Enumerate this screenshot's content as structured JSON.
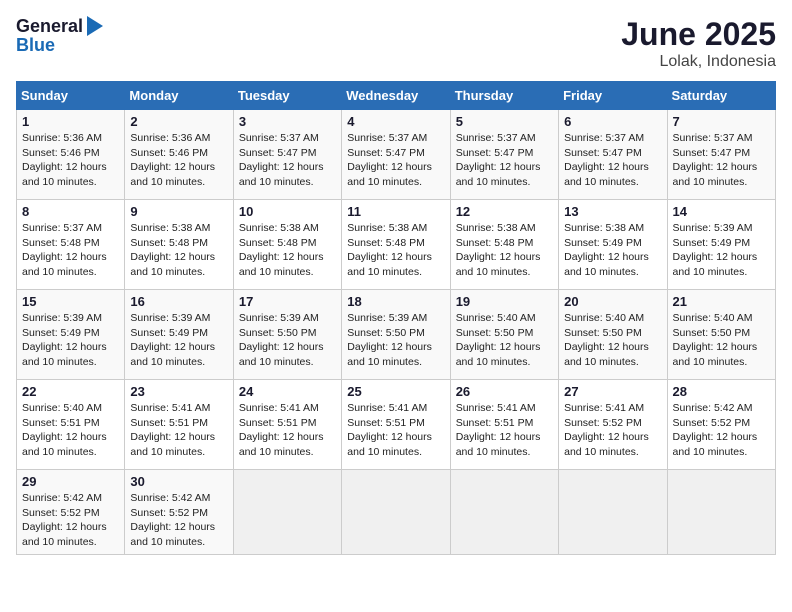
{
  "header": {
    "logo_general": "General",
    "logo_blue": "Blue",
    "title": "June 2025",
    "location": "Lolak, Indonesia"
  },
  "weekdays": [
    "Sunday",
    "Monday",
    "Tuesday",
    "Wednesday",
    "Thursday",
    "Friday",
    "Saturday"
  ],
  "weeks": [
    [
      {
        "day": "1",
        "sunrise": "5:36 AM",
        "sunset": "5:46 PM",
        "daylight": "12 hours and 10 minutes."
      },
      {
        "day": "2",
        "sunrise": "5:36 AM",
        "sunset": "5:46 PM",
        "daylight": "12 hours and 10 minutes."
      },
      {
        "day": "3",
        "sunrise": "5:37 AM",
        "sunset": "5:47 PM",
        "daylight": "12 hours and 10 minutes."
      },
      {
        "day": "4",
        "sunrise": "5:37 AM",
        "sunset": "5:47 PM",
        "daylight": "12 hours and 10 minutes."
      },
      {
        "day": "5",
        "sunrise": "5:37 AM",
        "sunset": "5:47 PM",
        "daylight": "12 hours and 10 minutes."
      },
      {
        "day": "6",
        "sunrise": "5:37 AM",
        "sunset": "5:47 PM",
        "daylight": "12 hours and 10 minutes."
      },
      {
        "day": "7",
        "sunrise": "5:37 AM",
        "sunset": "5:47 PM",
        "daylight": "12 hours and 10 minutes."
      }
    ],
    [
      {
        "day": "8",
        "sunrise": "5:37 AM",
        "sunset": "5:48 PM",
        "daylight": "12 hours and 10 minutes."
      },
      {
        "day": "9",
        "sunrise": "5:38 AM",
        "sunset": "5:48 PM",
        "daylight": "12 hours and 10 minutes."
      },
      {
        "day": "10",
        "sunrise": "5:38 AM",
        "sunset": "5:48 PM",
        "daylight": "12 hours and 10 minutes."
      },
      {
        "day": "11",
        "sunrise": "5:38 AM",
        "sunset": "5:48 PM",
        "daylight": "12 hours and 10 minutes."
      },
      {
        "day": "12",
        "sunrise": "5:38 AM",
        "sunset": "5:48 PM",
        "daylight": "12 hours and 10 minutes."
      },
      {
        "day": "13",
        "sunrise": "5:38 AM",
        "sunset": "5:49 PM",
        "daylight": "12 hours and 10 minutes."
      },
      {
        "day": "14",
        "sunrise": "5:39 AM",
        "sunset": "5:49 PM",
        "daylight": "12 hours and 10 minutes."
      }
    ],
    [
      {
        "day": "15",
        "sunrise": "5:39 AM",
        "sunset": "5:49 PM",
        "daylight": "12 hours and 10 minutes."
      },
      {
        "day": "16",
        "sunrise": "5:39 AM",
        "sunset": "5:49 PM",
        "daylight": "12 hours and 10 minutes."
      },
      {
        "day": "17",
        "sunrise": "5:39 AM",
        "sunset": "5:50 PM",
        "daylight": "12 hours and 10 minutes."
      },
      {
        "day": "18",
        "sunrise": "5:39 AM",
        "sunset": "5:50 PM",
        "daylight": "12 hours and 10 minutes."
      },
      {
        "day": "19",
        "sunrise": "5:40 AM",
        "sunset": "5:50 PM",
        "daylight": "12 hours and 10 minutes."
      },
      {
        "day": "20",
        "sunrise": "5:40 AM",
        "sunset": "5:50 PM",
        "daylight": "12 hours and 10 minutes."
      },
      {
        "day": "21",
        "sunrise": "5:40 AM",
        "sunset": "5:50 PM",
        "daylight": "12 hours and 10 minutes."
      }
    ],
    [
      {
        "day": "22",
        "sunrise": "5:40 AM",
        "sunset": "5:51 PM",
        "daylight": "12 hours and 10 minutes."
      },
      {
        "day": "23",
        "sunrise": "5:41 AM",
        "sunset": "5:51 PM",
        "daylight": "12 hours and 10 minutes."
      },
      {
        "day": "24",
        "sunrise": "5:41 AM",
        "sunset": "5:51 PM",
        "daylight": "12 hours and 10 minutes."
      },
      {
        "day": "25",
        "sunrise": "5:41 AM",
        "sunset": "5:51 PM",
        "daylight": "12 hours and 10 minutes."
      },
      {
        "day": "26",
        "sunrise": "5:41 AM",
        "sunset": "5:51 PM",
        "daylight": "12 hours and 10 minutes."
      },
      {
        "day": "27",
        "sunrise": "5:41 AM",
        "sunset": "5:52 PM",
        "daylight": "12 hours and 10 minutes."
      },
      {
        "day": "28",
        "sunrise": "5:42 AM",
        "sunset": "5:52 PM",
        "daylight": "12 hours and 10 minutes."
      }
    ],
    [
      {
        "day": "29",
        "sunrise": "5:42 AM",
        "sunset": "5:52 PM",
        "daylight": "12 hours and 10 minutes."
      },
      {
        "day": "30",
        "sunrise": "5:42 AM",
        "sunset": "5:52 PM",
        "daylight": "12 hours and 10 minutes."
      },
      null,
      null,
      null,
      null,
      null
    ]
  ]
}
